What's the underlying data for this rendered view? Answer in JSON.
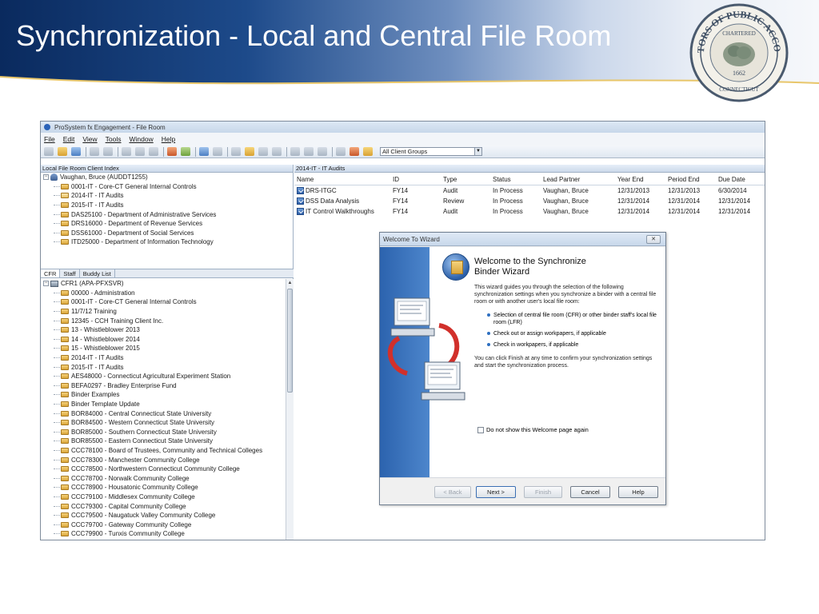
{
  "slide": {
    "title": "Synchronization - Local and Central File Room"
  },
  "seal": {
    "outer_text": "AUDITORS OF PUBLIC ACCOUNTS",
    "inner_text": "CHARTERED",
    "year": "1662",
    "bottom_text": "CONNECTICUT"
  },
  "app": {
    "window_title": "ProSystem fx Engagement - File Room",
    "menu": [
      "File",
      "Edit",
      "View",
      "Tools",
      "Window",
      "Help"
    ],
    "client_groups_value": "All Client Groups",
    "local_panel_title": "Local File Room Client Index",
    "local_tree": [
      {
        "label": "Vaughan, Bruce (AUDDT1255)",
        "kind": "person",
        "level": 0
      },
      {
        "label": "0001-IT - Core-CT General Internal Controls",
        "kind": "folder",
        "level": 1
      },
      {
        "label": "2014-IT - IT Audits",
        "kind": "folder-open",
        "level": 1
      },
      {
        "label": "2015-IT - IT Audits",
        "kind": "folder",
        "level": 1
      },
      {
        "label": "DAS25100 - Department of Administrative Services",
        "kind": "folder",
        "level": 1
      },
      {
        "label": "DRS16000 - Department of Revenue Services",
        "kind": "folder",
        "level": 1
      },
      {
        "label": "DSS61000 - Department of Social Services",
        "kind": "folder",
        "level": 1
      },
      {
        "label": "ITD25000 - Department of Information Technology",
        "kind": "folder",
        "level": 1
      }
    ],
    "tabs": [
      "CFR",
      "Staff",
      "Buddy List"
    ],
    "cfr_root": "CFR1 (APA-PFXSVR)",
    "cfr_items": [
      "00000 - Administration",
      "0001-IT - Core-CT General Internal Controls",
      "11/7/12 Training",
      "12345 - CCH Training Client Inc.",
      "13 - Whistleblower 2013",
      "14 - Whistleblower 2014",
      "15 - Whistleblower 2015",
      "2014-IT - IT Audits",
      "2015-IT - IT Audits",
      "AES48000 - Connecticut Agricultural Experiment Station",
      "BEFA0297 - Bradley Enterprise Fund",
      "Binder Examples",
      "Binder Template Update",
      "BOR84000 - Central Connecticut State University",
      "BOR84500 - Western Connecticut State University",
      "BOR85000 - Southern Connecticut State University",
      "BOR85500 - Eastern Connecticut State University",
      "CCC78100 - Board of Trustees, Community and Technical Colleges",
      "CCC78300 - Manchester Community College",
      "CCC78500 - Northwestern Connecticut Community College",
      "CCC78700 - Norwalk Community College",
      "CCC78900 - Housatonic Community College",
      "CCC79100 - Middlesex Community College",
      "CCC79300 - Capital Community College",
      "CCC79500 - Naugatuck Valley Community College",
      "CCC79700 - Gateway Community College",
      "CCC79900 - Tunxis Community College"
    ],
    "grid_panel_title": "2014-IT - IT Audits",
    "grid_columns": [
      "Name",
      "ID",
      "Type",
      "Status",
      "Lead Partner",
      "Year End",
      "Period End",
      "Due Date"
    ],
    "grid_rows": [
      [
        "DRS-ITGC",
        "FY14",
        "Audit",
        "In Process",
        "Vaughan, Bruce",
        "12/31/2013",
        "12/31/2013",
        "6/30/2014"
      ],
      [
        "DSS Data Analysis",
        "FY14",
        "Review",
        "In Process",
        "Vaughan, Bruce",
        "12/31/2014",
        "12/31/2014",
        "12/31/2014"
      ],
      [
        "IT Control Walkthroughs",
        "FY14",
        "Audit",
        "In Process",
        "Vaughan, Bruce",
        "12/31/2014",
        "12/31/2014",
        "12/31/2014"
      ]
    ]
  },
  "wizard": {
    "title": "Welcome To Wizard",
    "heading_line1": "Welcome to the Synchronize",
    "heading_line2": "Binder Wizard",
    "intro": "This wizard guides you through the selection of the following synchronization settings when you synchronize a binder with a central file room or with another user's local file room:",
    "bullets": [
      "Selection of central file room (CFR) or other binder staff's local file room (LFR)",
      "Check out or assign workpapers, if applicable",
      "Check in workpapers, if applicable"
    ],
    "finish_note": "You can click Finish at any time to confirm your synchronization settings and start the synchronization process.",
    "checkbox_label": "Do not show this Welcome page again",
    "buttons": {
      "back": "< Back",
      "next": "Next >",
      "finish": "Finish",
      "cancel": "Cancel",
      "help": "Help"
    }
  }
}
